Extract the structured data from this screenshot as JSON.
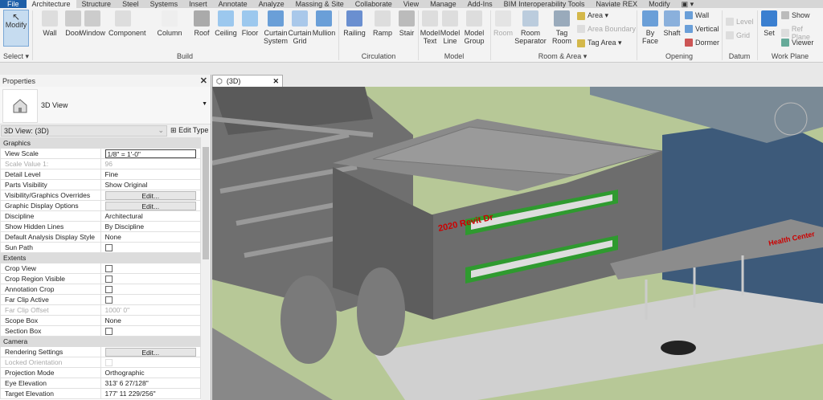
{
  "tabs": [
    "File",
    "Architecture",
    "Structure",
    "Steel",
    "Systems",
    "Insert",
    "Annotate",
    "Analyze",
    "Massing & Site",
    "Collaborate",
    "View",
    "Manage",
    "Add-Ins",
    "BIM Interoperability Tools",
    "Naviate REX",
    "Modify"
  ],
  "ribbon": {
    "select": {
      "modify": "Modify",
      "label": "Select ▾"
    },
    "build": {
      "label": "Build",
      "tools": [
        "Wall",
        "Door",
        "Window",
        "Component",
        "Column",
        "Roof",
        "Ceiling",
        "Floor",
        "Curtain System",
        "Curtain Grid",
        "Mullion"
      ]
    },
    "circulation": {
      "label": "Circulation",
      "tools": [
        "Railing",
        "Ramp",
        "Stair"
      ]
    },
    "model": {
      "label": "Model",
      "tools": [
        "Model Text",
        "Model Line",
        "Model Group"
      ]
    },
    "room_area": {
      "label": "Room & Area ▾",
      "tools": [
        "Room",
        "Room Separator",
        "Tag Room"
      ],
      "small": [
        "Area ▾",
        "Area Boundary",
        "Tag Area ▾"
      ]
    },
    "opening": {
      "label": "Opening",
      "tools": [
        "By Face",
        "Shaft"
      ],
      "small": [
        "Wall",
        "Vertical",
        "Dormer"
      ]
    },
    "datum": {
      "label": "Datum",
      "small": [
        "Level",
        "Grid"
      ]
    },
    "workplane": {
      "label": "Work Plane",
      "tools": [
        "Set"
      ],
      "small": [
        "Show",
        "Ref Plane",
        "Viewer"
      ]
    }
  },
  "properties": {
    "title": "Properties",
    "type_name": "3D View",
    "view_selector": "3D View: (3D)",
    "edit_type": "Edit Type",
    "groups": [
      {
        "name": "Graphics",
        "rows": [
          {
            "k": "View Scale",
            "v": "1/8\" = 1'-0\"",
            "kind": "input"
          },
          {
            "k": "Scale Value    1:",
            "v": "96",
            "kind": "ro"
          },
          {
            "k": "Detail Level",
            "v": "Fine"
          },
          {
            "k": "Parts Visibility",
            "v": "Show Original"
          },
          {
            "k": "Visibility/Graphics Overrides",
            "v": "Edit...",
            "kind": "btn"
          },
          {
            "k": "Graphic Display Options",
            "v": "Edit...",
            "kind": "btn"
          },
          {
            "k": "Discipline",
            "v": "Architectural"
          },
          {
            "k": "Show Hidden Lines",
            "v": "By Discipline"
          },
          {
            "k": "Default Analysis Display Style",
            "v": "None"
          },
          {
            "k": "Sun Path",
            "v": "",
            "kind": "cb"
          }
        ]
      },
      {
        "name": "Extents",
        "rows": [
          {
            "k": "Crop View",
            "v": "",
            "kind": "cb"
          },
          {
            "k": "Crop Region Visible",
            "v": "",
            "kind": "cb"
          },
          {
            "k": "Annotation Crop",
            "v": "",
            "kind": "cb"
          },
          {
            "k": "Far Clip Active",
            "v": "",
            "kind": "cb"
          },
          {
            "k": "Far Clip Offset",
            "v": "1000'  0\"",
            "kind": "ro"
          },
          {
            "k": "Scope Box",
            "v": "None"
          },
          {
            "k": "Section Box",
            "v": "",
            "kind": "cb"
          }
        ]
      },
      {
        "name": "Camera",
        "rows": [
          {
            "k": "Rendering Settings",
            "v": "Edit...",
            "kind": "btn"
          },
          {
            "k": "Locked Orientation",
            "v": "",
            "kind": "rocb"
          },
          {
            "k": "Projection Mode",
            "v": "Orthographic"
          },
          {
            "k": "Eye Elevation",
            "v": "313'  6 27/128\""
          },
          {
            "k": "Target Elevation",
            "v": "177'  11 229/256\""
          }
        ]
      }
    ]
  },
  "view_tab": {
    "label": "(3D)"
  },
  "viewport": {
    "sign1": "2020 Revit Dr",
    "sign2": "Health Center"
  }
}
